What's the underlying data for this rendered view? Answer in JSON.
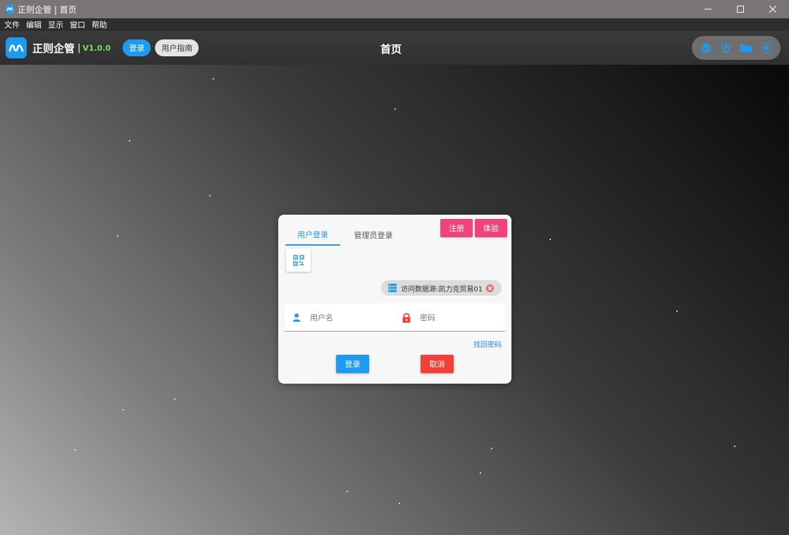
{
  "window": {
    "title": "正则企管 | 首页"
  },
  "menu": [
    "文件",
    "编辑",
    "显示",
    "窗口",
    "帮助"
  ],
  "header": {
    "app_name": "正则企管",
    "separator": "|",
    "version": "V1.0.0",
    "login_label": "登录",
    "guide_label": "用户指南",
    "page_title": "首页",
    "tools": [
      "layers-icon",
      "stethoscope-icon",
      "folder-icon",
      "sun-icon"
    ]
  },
  "login": {
    "tabs": [
      {
        "label": "用户登录",
        "active": true
      },
      {
        "label": "管理员登录",
        "active": false
      }
    ],
    "register_label": "注册",
    "trial_label": "体验",
    "datasource_label": "访问数据源:凯力克贸易01",
    "username_placeholder": "用户名",
    "password_placeholder": "密码",
    "forgot_label": "找回密码",
    "submit_label": "登录",
    "cancel_label": "取消"
  },
  "colors": {
    "accent": "#1e9bf0",
    "pink": "#f0437a",
    "danger": "#f04136",
    "version": "#7fdc5a"
  }
}
